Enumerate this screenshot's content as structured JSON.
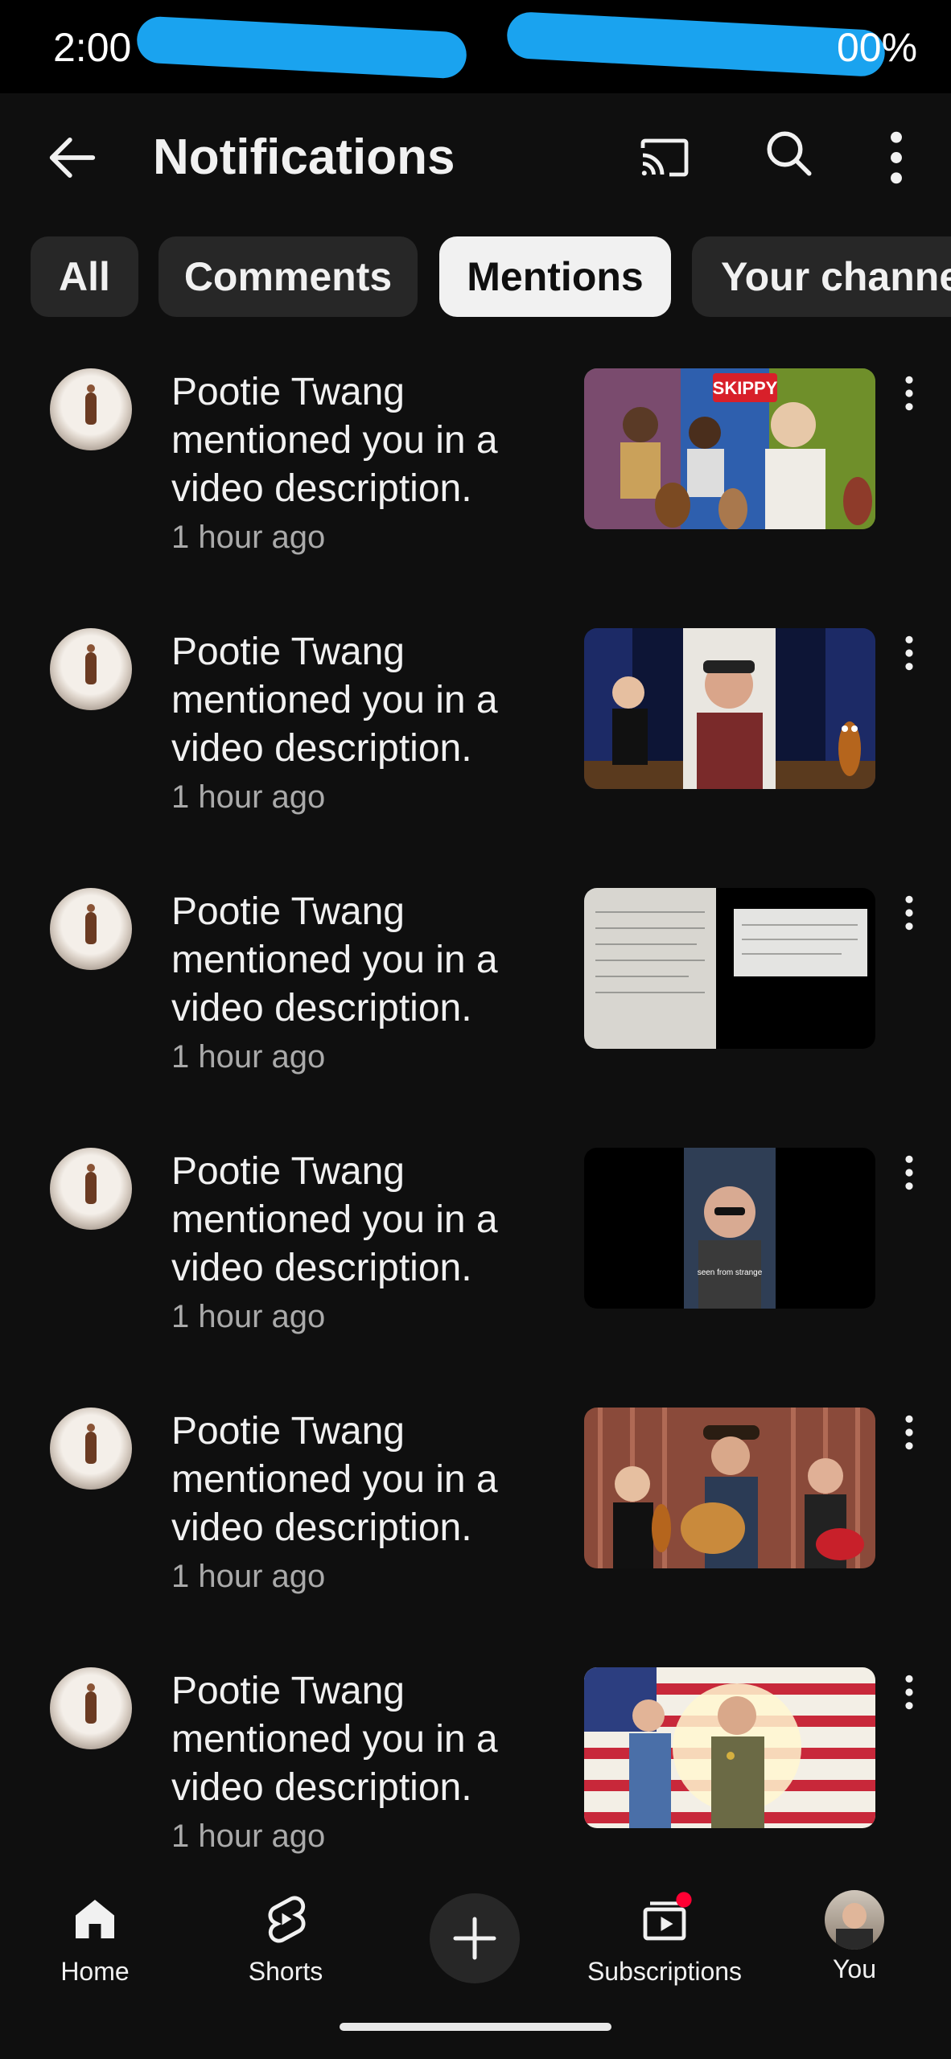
{
  "status_bar": {
    "time": "2:00",
    "battery": "00%"
  },
  "header": {
    "title": "Notifications"
  },
  "tabs": [
    {
      "label": "All"
    },
    {
      "label": "Comments"
    },
    {
      "label": "Mentions"
    },
    {
      "label": "Your channe"
    }
  ],
  "active_tab": "Mentions",
  "notifications": [
    {
      "text": "Pootie Twang mentioned you in a video description.",
      "time": "1 hour ago",
      "thumbnail": "skippy-collage",
      "thumbnail_text": "SKIPPY"
    },
    {
      "text": "Pootie Twang mentioned you in a video description.",
      "time": "1 hour ago",
      "thumbnail": "video-call-stage"
    },
    {
      "text": "Pootie Twang mentioned you in a video description.",
      "time": "1 hour ago",
      "thumbnail": "document-photo"
    },
    {
      "text": "Pootie Twang mentioned you in a video description.",
      "time": "1 hour ago",
      "thumbnail": "selfie-video",
      "thumbnail_text": "seen from strange"
    },
    {
      "text": "Pootie Twang mentioned you in a video description.",
      "time": "1 hour ago",
      "thumbnail": "guitar-trio"
    },
    {
      "text": "Pootie Twang mentioned you in a video description.",
      "time": "1 hour ago",
      "thumbnail": "flag-sheriff"
    }
  ],
  "bottom_nav": [
    {
      "label": "Home",
      "icon": "home-icon"
    },
    {
      "label": "Shorts",
      "icon": "shorts-icon"
    },
    {
      "label": "",
      "icon": "plus-icon"
    },
    {
      "label": "Subscriptions",
      "icon": "subscriptions-icon"
    },
    {
      "label": "You",
      "icon": "avatar"
    }
  ],
  "colors": {
    "background": "#0f0f0f",
    "chip": "#272727",
    "chip_active": "#f1f1f1",
    "notification_dot": "#ff0033",
    "secondary_text": "#aaaaaa"
  }
}
